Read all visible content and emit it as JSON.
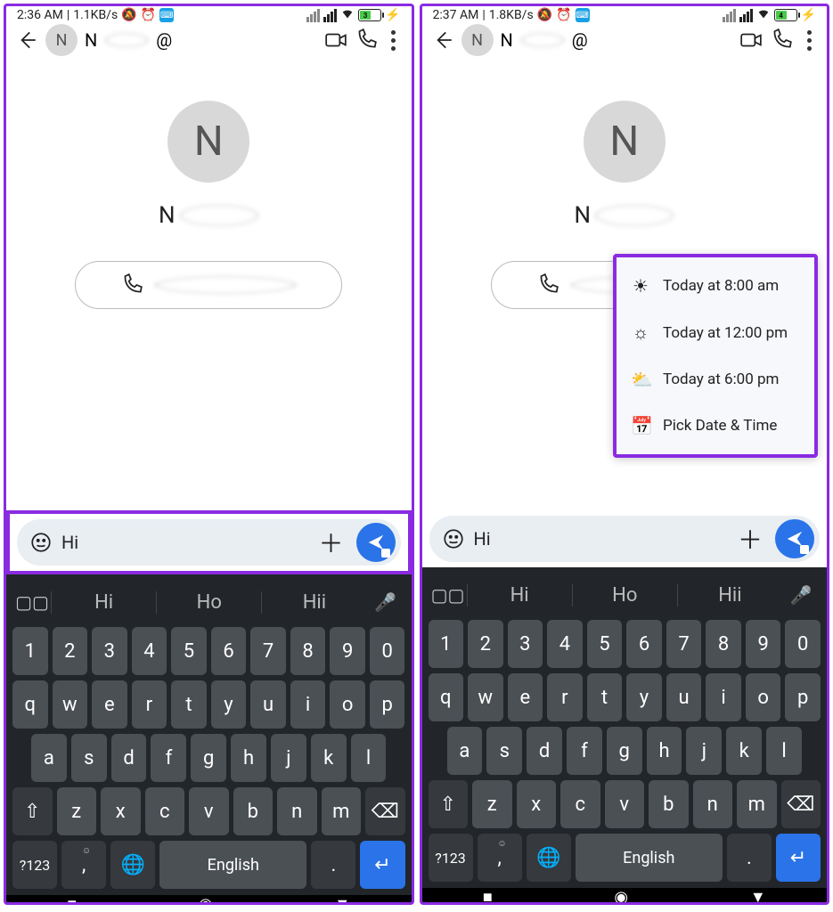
{
  "left": {
    "status": {
      "time": "2:36 AM",
      "rate": "1.1KB/s",
      "battery": "3"
    },
    "appbar": {
      "contact_initial": "N",
      "contact_letter": "N",
      "at": "@"
    },
    "body": {
      "avatar_letter": "N",
      "name_prefix": "N"
    },
    "input": {
      "text": "Hi"
    },
    "keyboard": {
      "suggestions": [
        "Hi",
        "Ho",
        "Hii"
      ],
      "row_num": [
        "1",
        "2",
        "3",
        "4",
        "5",
        "6",
        "7",
        "8",
        "9",
        "0"
      ],
      "row_q": [
        "q",
        "w",
        "e",
        "r",
        "t",
        "y",
        "u",
        "i",
        "o",
        "p"
      ],
      "row_a": [
        "a",
        "s",
        "d",
        "f",
        "g",
        "h",
        "j",
        "k",
        "l"
      ],
      "row_z": [
        "z",
        "x",
        "c",
        "v",
        "b",
        "n",
        "m"
      ],
      "sym": "?123",
      "comma": ",",
      "period": ".",
      "lang": "English"
    }
  },
  "right": {
    "status": {
      "time": "2:37 AM",
      "rate": "1.8KB/s",
      "battery": "4"
    },
    "appbar": {
      "contact_initial": "N",
      "contact_letter": "N",
      "at": "@"
    },
    "body": {
      "avatar_letter": "N",
      "name_prefix": "N"
    },
    "input": {
      "text": "Hi"
    },
    "schedule": [
      {
        "icon": "sunrise",
        "label": "Today at 8:00 am"
      },
      {
        "icon": "sun",
        "label": "Today at 12:00 pm"
      },
      {
        "icon": "sunset",
        "label": "Today at 6:00 pm"
      },
      {
        "icon": "calendar",
        "label": "Pick Date & Time"
      }
    ],
    "keyboard": {
      "suggestions": [
        "Hi",
        "Ho",
        "Hii"
      ],
      "row_num": [
        "1",
        "2",
        "3",
        "4",
        "5",
        "6",
        "7",
        "8",
        "9",
        "0"
      ],
      "row_q": [
        "q",
        "w",
        "e",
        "r",
        "t",
        "y",
        "u",
        "i",
        "o",
        "p"
      ],
      "row_a": [
        "a",
        "s",
        "d",
        "f",
        "g",
        "h",
        "j",
        "k",
        "l"
      ],
      "row_z": [
        "z",
        "x",
        "c",
        "v",
        "b",
        "n",
        "m"
      ],
      "sym": "?123",
      "comma": ",",
      "period": ".",
      "lang": "English"
    }
  }
}
